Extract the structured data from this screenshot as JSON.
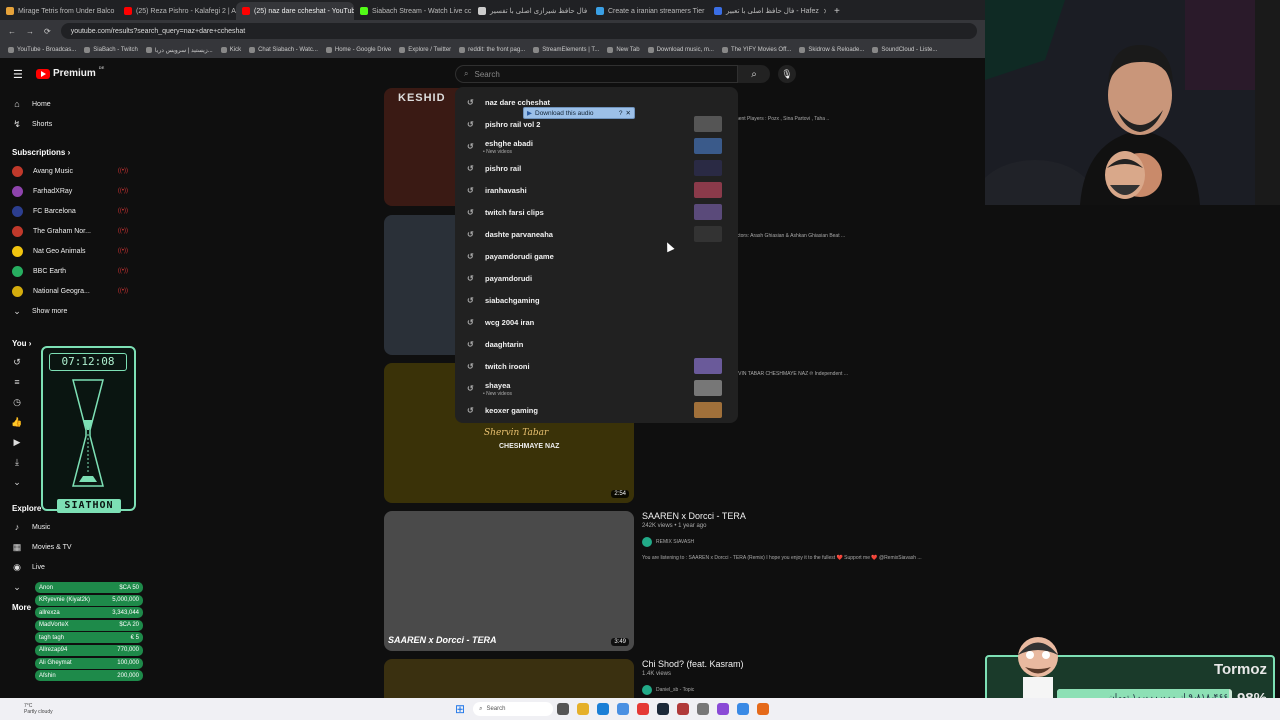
{
  "browser": {
    "tabs": [
      {
        "title": "Mirage Tetris from Under Balco",
        "color": "#e5a23a"
      },
      {
        "title": "(25) Reza Pishro - Kalafegi 2 | A",
        "color": "#ff0000"
      },
      {
        "title": "(25) naz dare ccheshat - YouTub",
        "color": "#ff0000",
        "active": true
      },
      {
        "title": "Siabach Stream - Watch Live cc",
        "color": "#53fc18"
      },
      {
        "title": "فال حافظ شیرازی اصلی با تفسیر",
        "color": "#cccccc"
      },
      {
        "title": "Create a iranian streamers Tier",
        "color": "#3aa0e5"
      },
      {
        "title": "فال حافظ اصلی با تعبیر - Hafez",
        "color": "#3a6ee5"
      }
    ],
    "address": "youtube.com/results?search_query=naz+dare+ccheshat",
    "bookmarks": [
      "YouTube - Broadcas...",
      "SiaBach - Twitch",
      "زیستید | سرویس دریا...",
      "Kick",
      "Chat Siabach - Watc...",
      "Home - Google Drive",
      "Explore / Twitter",
      "reddit: the front pag...",
      "StreamElements | T...",
      "New Tab",
      "Download music, m...",
      "The YIFY Movies Off...",
      "Skidrow & Reloade...",
      "SoundCloud - Liste..."
    ]
  },
  "youtube": {
    "logo": "Premium",
    "logo_badge": "DE",
    "search_placeholder": "Search",
    "sidebar": {
      "home": "Home",
      "shorts": "Shorts",
      "subscriptions_header": "Subscriptions",
      "subscriptions": [
        {
          "name": "Avang Music",
          "color": "#c0392b"
        },
        {
          "name": "FarhadXRay",
          "color": "#8e44ad"
        },
        {
          "name": "FC Barcelona",
          "color": "#2c3e8f"
        },
        {
          "name": "The Graham Nor...",
          "color": "#c0392b"
        },
        {
          "name": "Nat Geo Animals",
          "color": "#f1c40f"
        },
        {
          "name": "BBC Earth",
          "color": "#27ae60"
        },
        {
          "name": "National Geogra...",
          "color": "#d4ac0d"
        }
      ],
      "show_more": "Show more",
      "you_header": "You",
      "explore_header": "Explore",
      "explore": [
        "Music",
        "Movies & TV",
        "Live"
      ],
      "more_header": "More"
    },
    "suggestions": [
      {
        "text": "naz dare ccheshat"
      },
      {
        "text": "pishro rail vol 2",
        "thumb": "#555"
      },
      {
        "text": "eshghe abadi",
        "sub": "• New videos",
        "thumb": "#3a5a8a"
      },
      {
        "text": "pishro rail",
        "thumb": "#2a2a44"
      },
      {
        "text": "iranhavashi",
        "thumb": "#8a3a4a"
      },
      {
        "text": "twitch farsi clips",
        "thumb": "#5a4a7a"
      },
      {
        "text": "dashte parvaneaha",
        "thumb": "#333"
      },
      {
        "text": "payamdorudi game"
      },
      {
        "text": "payamdorudi"
      },
      {
        "text": "siabachgaming"
      },
      {
        "text": "wcg 2004 iran"
      },
      {
        "text": "daaghtarin"
      },
      {
        "text": "twitch irooni",
        "thumb": "#6a5a9a"
      },
      {
        "text": "shayea",
        "sub": "• New videos",
        "thumb": "#777"
      },
      {
        "text": "keoxer gaming",
        "thumb": "#a0703a"
      }
    ],
    "download_label": "Download this audio",
    "videos": [
      {
        "title": "",
        "desc": "ANCE Director : Amirmehdi Ahmadi Instrument Players : Pozx , Sina Partovi , Taha ..",
        "thumb_color": "#3a1a14",
        "thumb_label": "KESHID"
      },
      {
        "title": "cial Music Video)",
        "desc": "deo) Black Pyramid Studio Production Directors: Arash Ghiasian & Ashkan Ghiasian Beat ...",
        "thumb_color": "#2a3038"
      },
      {
        "title": "",
        "desc": "CHESHMAYE NAZ · Shervin Tabar · SHERVIN TABAR CHESHMAYE NAZ ℗ Independent ...",
        "thumb_color": "#3a3208",
        "thumb_script": "Shervin Tabar",
        "thumb_caption": "CHESHMAYE NAZ",
        "duration": "2:54"
      },
      {
        "title": "SAAREN x Dorcci - TERA",
        "meta": "242K views • 1 year ago",
        "channel": "REMIX SIAVASH",
        "desc": "You are listening to : SAAREN x Dorcci - TERA (Remix) I hope you enjoy it to the fullest ❤️ Support me ❤️ @RemixSiavash ...",
        "thumb_color": "#4a4a4a",
        "thumb_caption": "SAAREN x Dorcci - TERA",
        "duration": "3:49"
      },
      {
        "title": "Chi Shod? (feat. Kasram)",
        "meta": "1.4K views",
        "channel": "Daniel_sb - Topic",
        "thumb_color": "#3a3010"
      }
    ]
  },
  "stream_overlay": {
    "timer": "07:12:08",
    "brand": "SIATHON",
    "donations": [
      {
        "name": "Anon",
        "amount": "$CA 50"
      },
      {
        "name": "KRyevnie (Kiyat2k)",
        "amount": "5,000,000"
      },
      {
        "name": "allrexza",
        "amount": "3,343,044"
      },
      {
        "name": "MadVorteX",
        "amount": "$CA 20"
      },
      {
        "name": "tagh tagh",
        "amount": "€ 5"
      },
      {
        "name": "Allrezap94",
        "amount": "770,000"
      },
      {
        "name": "Ali Gheymat",
        "amount": "100,000"
      },
      {
        "name": "Afshin",
        "amount": "200,000"
      }
    ],
    "goal_name": "Tormoz",
    "goal_text": "۹٫۸۱۸٫۴۶۶ از ۱۰٫۰۰۰٫۰۰۰ تومان",
    "goal_percent": "98%"
  },
  "taskbar": {
    "weather_temp": "7°C",
    "weather_desc": "Partly cloudy",
    "search": "Search"
  }
}
